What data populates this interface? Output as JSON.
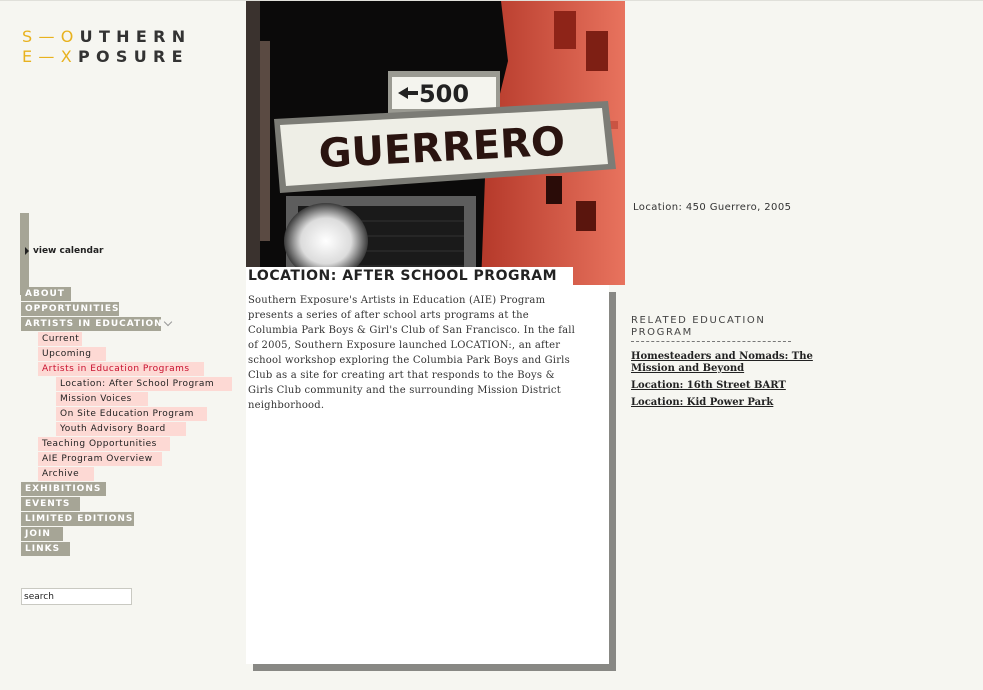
{
  "logo": {
    "line1_accent": "S—O",
    "line1_rest": "UTHERN",
    "line2_accent": "E—X",
    "line2_rest": "POSURE"
  },
  "sidebar": {
    "calendar_label": "view calendar",
    "search_value": "search",
    "nav": [
      {
        "label": "ABOUT",
        "level": 0
      },
      {
        "label": "OPPORTUNITIES",
        "level": 0
      },
      {
        "label": "ARTISTS IN EDUCATION",
        "level": 0
      },
      {
        "label": "Current",
        "level": 1
      },
      {
        "label": "Upcoming",
        "level": 1
      },
      {
        "label": "Artists in Education Programs",
        "level": 1,
        "active": true
      },
      {
        "label": "Location: After School Program",
        "level": 2
      },
      {
        "label": "Mission Voices",
        "level": 2
      },
      {
        "label": "On Site Education Program",
        "level": 2
      },
      {
        "label": "Youth Advisory Board",
        "level": 2
      },
      {
        "label": "Teaching Opportunities",
        "level": 1
      },
      {
        "label": "AIE Program Overview",
        "level": 1
      },
      {
        "label": "Archive",
        "level": 1
      },
      {
        "label": "EXHIBITIONS",
        "level": 0
      },
      {
        "label": "EVENTS",
        "level": 0
      },
      {
        "label": "LIMITED EDITIONS",
        "level": 0
      },
      {
        "label": "JOIN",
        "level": 0
      },
      {
        "label": "LINKS",
        "level": 0
      }
    ]
  },
  "hero": {
    "sign_number": "500",
    "sign_street": "GUERRERO"
  },
  "main": {
    "title": "LOCATION: AFTER SCHOOL PROGRAM",
    "body": "Southern Exposure's Artists in Education (AIE) Program presents a series of after school arts programs at the Columbia Park Boys & Girl's Club of San Francisco. In the fall of 2005, Southern Exposure launched LOCATION:, an after school workshop exploring the Columbia Park Boys and Girls Club as a site for creating art that responds to the Boys & Girls Club community and the surrounding Mission District neighborhood."
  },
  "right": {
    "caption": "Location: 450 Guerrero, 2005",
    "related_heading": "RELATED EDUCATION PROGRAM",
    "related_links": [
      "Homesteaders and Nomads: The Mission and Beyond",
      "Location: 16th Street BART",
      "Location: Kid Power Park"
    ]
  },
  "colors": {
    "background": "#f6f6f1",
    "nav_primary": "#a6a596",
    "nav_sub": "#fdd9d4",
    "accent_red": "#c8102e",
    "logo_yellow": "#e8b21f"
  }
}
